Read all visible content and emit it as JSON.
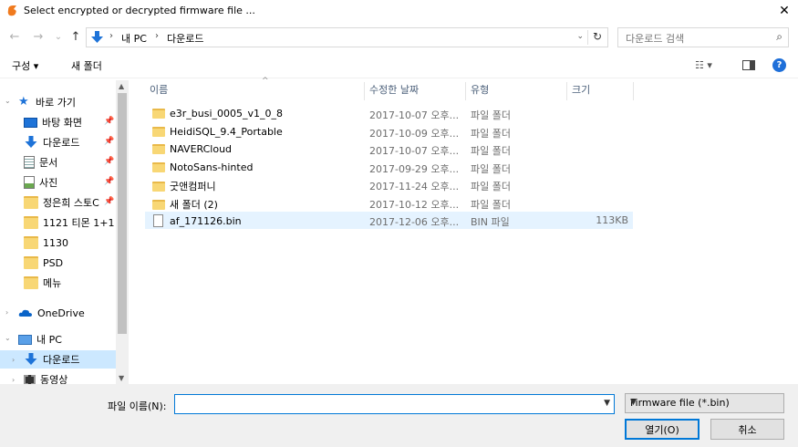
{
  "window": {
    "title": "Select encrypted or decrypted firmware file ...",
    "close_label": "✕"
  },
  "address": {
    "back_glyph": "←",
    "forward_glyph": "→",
    "recent_glyph": "⌄",
    "up_glyph": "↑",
    "segments": [
      "내 PC",
      "다운로드"
    ],
    "separator": "›",
    "dropdown_glyph": "⌄",
    "refresh_glyph": "↻",
    "search_placeholder": "다운로드 검색",
    "search_glyph": "⌕"
  },
  "toolbar": {
    "organize_label": "구성 ▾",
    "new_folder_label": "새 폴더",
    "view_glyph": "☷ ▾",
    "help_glyph": "?"
  },
  "nav": {
    "quick_access": "바로 가기",
    "items": [
      {
        "label": "바탕 화면",
        "icon": "desktop-icon",
        "pinned": true
      },
      {
        "label": "다운로드",
        "icon": "download-icon",
        "pinned": true
      },
      {
        "label": "문서",
        "icon": "document-icon",
        "pinned": true
      },
      {
        "label": "사진",
        "icon": "pictures-icon",
        "pinned": true
      },
      {
        "label": "정은희 스토C",
        "icon": "folder-icon",
        "pinned": true
      },
      {
        "label": "1121 티몬 1+1",
        "icon": "folder-icon",
        "pinned": false
      },
      {
        "label": "1130",
        "icon": "folder-icon",
        "pinned": false
      },
      {
        "label": "PSD",
        "icon": "folder-icon",
        "pinned": false
      },
      {
        "label": "메뉴",
        "icon": "folder-icon",
        "pinned": false
      }
    ],
    "onedrive": "OneDrive",
    "this_pc": "내 PC",
    "pc_children": [
      {
        "label": "다운로드",
        "icon": "download-icon"
      },
      {
        "label": "동영상",
        "icon": "video-icon"
      }
    ],
    "pin_glyph": "📌"
  },
  "columns": {
    "name": "이름",
    "date": "수정한 날짜",
    "type": "유형",
    "size": "크기"
  },
  "files": [
    {
      "name": "e3r_busi_0005_v1_0_8",
      "date": "2017-10-07 오후...",
      "type": "파일 폴더",
      "size": "",
      "kind": "folder"
    },
    {
      "name": "HeidiSQL_9.4_Portable",
      "date": "2017-10-09 오후...",
      "type": "파일 폴더",
      "size": "",
      "kind": "folder"
    },
    {
      "name": "NAVERCloud",
      "date": "2017-10-07 오후...",
      "type": "파일 폴더",
      "size": "",
      "kind": "folder"
    },
    {
      "name": "NotoSans-hinted",
      "date": "2017-09-29 오후...",
      "type": "파일 폴더",
      "size": "",
      "kind": "folder"
    },
    {
      "name": "굿앤컴퍼니",
      "date": "2017-11-24 오후...",
      "type": "파일 폴더",
      "size": "",
      "kind": "folder"
    },
    {
      "name": "새 폴더 (2)",
      "date": "2017-10-12 오후...",
      "type": "파일 폴더",
      "size": "",
      "kind": "folder"
    },
    {
      "name": "af_171126.bin",
      "date": "2017-12-06 오후...",
      "type": "BIN 파일",
      "size": "113KB",
      "kind": "file"
    }
  ],
  "bottom": {
    "filename_label": "파일 이름(N):",
    "filename_value": "",
    "filetype_value": "Firmware file (*.bin)",
    "open_label": "열기(O)",
    "cancel_label": "취소"
  },
  "colors": {
    "accent": "#0078d7",
    "folder": "#f8d775",
    "selection": "#cce8ff"
  }
}
